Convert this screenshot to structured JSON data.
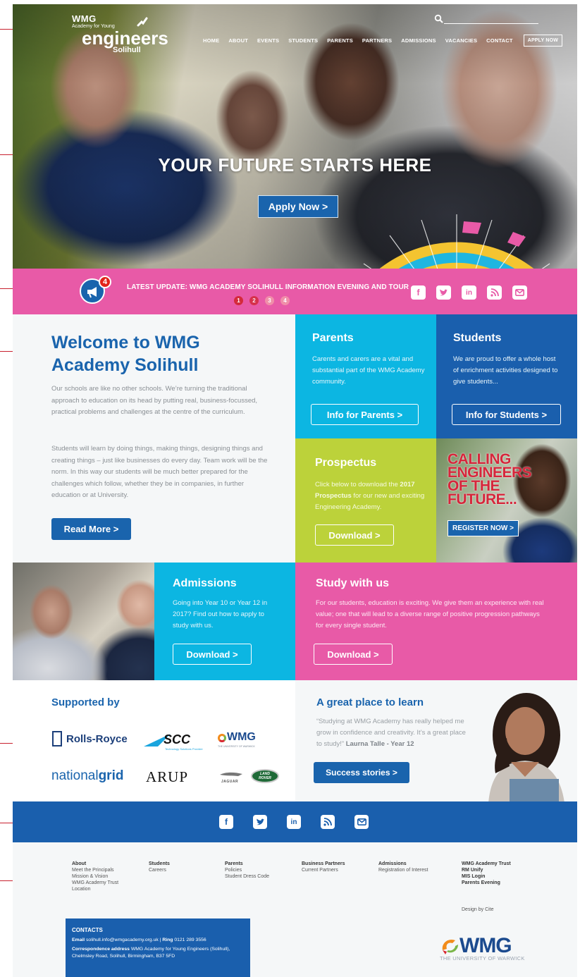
{
  "logo": {
    "line1": "WMG",
    "line2": "Academy for Young",
    "line3": "engineers",
    "line4": "Solihull"
  },
  "nav": {
    "items": [
      "HOME",
      "ABOUT",
      "EVENTS",
      "STUDENTS",
      "PARENTS",
      "PARTNERS",
      "ADMISSIONS",
      "VACANCIES",
      "CONTACT"
    ],
    "apply": "APPLY NOW",
    "search_icon": "search-icon"
  },
  "hero": {
    "title": "YOUR FUTURE STARTS HERE",
    "button": "Apply Now >"
  },
  "ticker": {
    "badge": "4",
    "text": "LATEST UPDATE: WMG ACADEMY SOLIHULL INFORMATION EVENING AND TOUR",
    "dots": [
      "1",
      "2",
      "3",
      "4"
    ],
    "social_icons": [
      "f",
      "t",
      "in",
      "rss",
      "mail"
    ]
  },
  "welcome": {
    "title": "Welcome to WMG Academy Solihull",
    "p1": "Our schools are like no other schools. We’re turning the traditional approach to education on its head by putting real, business-focussed, practical problems and challenges at the centre of the curriculum.",
    "p2": "Students will learn by doing things, making things, designing things and creating things – just like businesses do every day. Team work will be the norm. In this way our students will be much better prepared for the challenges which follow, whether they be in companies, in further education or at University.",
    "button": "Read More  >"
  },
  "parents": {
    "title": "Parents",
    "text": "Carents and carers are a vital and substantial part of the WMG Academy community.",
    "button": "Info for Parents  >"
  },
  "students": {
    "title": "Students",
    "text": "We are proud to offer a whole host of enrichment activities designed to give students...",
    "button": "Info for Students  >"
  },
  "prospectus": {
    "title": "Prospectus",
    "text_a": "Click below to download the ",
    "text_bold": "2017 Prospectus",
    "text_b": " for our new and exciting Engineering Academy.",
    "button": "Download  >"
  },
  "calling": {
    "lines": [
      "CALLING",
      "ENGINEERS",
      "OF THE",
      "FUTURE..."
    ],
    "button": "REGISTER NOW >"
  },
  "admissions": {
    "title": "Admissions",
    "text": "Going into Year 10 or Year 12 in 2017? Find out how to apply to study with us.",
    "button": "Download  >"
  },
  "study": {
    "title": "Study with us",
    "text": "For our students, education is exciting. We give them an experience with real value; one that will lead to a diverse range of positive progression pathways for every single student.",
    "button": "Download  >"
  },
  "supported": {
    "title": "Supported by",
    "logos": [
      "Rolls-Royce",
      "SCC",
      "WMG",
      "nationalgrid",
      "ARUP",
      "JAGUAR",
      "LAND ROVER"
    ],
    "scc_sub": "Technology Solutions Provider",
    "wmg_sub": "THE UNIVERSITY OF WARWICK",
    "ng_a": "national",
    "ng_b": "grid"
  },
  "great": {
    "title": "A great place to learn",
    "quote": "“Studying at WMG Academy has really helped me grow in confidence and creativity. It’s a great place to study!”",
    "author": "Laurna Talle - Year 12",
    "button": "Success stories  >"
  },
  "footer": {
    "columns": [
      {
        "heading": "About",
        "items": [
          "Meet the Principals",
          "Mission & Vision",
          "WMG Academy Trust",
          "Location"
        ]
      },
      {
        "heading": "Students",
        "items": [
          "Careers"
        ]
      },
      {
        "heading": "Parents",
        "items": [
          "Policies",
          "Student Dress Code"
        ]
      },
      {
        "heading": "Business Partners",
        "items": [
          "Current Partners"
        ]
      },
      {
        "heading": "Admissions",
        "items": [
          "Registration of Interest"
        ]
      },
      {
        "heading": "WMG Academy Trust",
        "items": [
          "RM Unify",
          "MIS Login",
          "Parents Evening"
        ]
      }
    ],
    "design": "Design by Cite",
    "contacts_title": "CONTACTS",
    "email_label": "Email",
    "email": "solihull.info@wmgacademy.org.uk",
    "ring_label": "Ring",
    "phone": "0121 289 3556",
    "address_label": "Correspondence address",
    "address": "WMG Academy for Young Engineers (Solihull), Chelmsley Road, Solihull, Birmingham, B37 5FD",
    "logo_word": "WMG",
    "logo_sub": "THE UNIVERSITY OF WARWICK"
  },
  "colors": {
    "pink": "#e85aa7",
    "blue": "#1a64ad",
    "cyan": "#0cb6e2",
    "lime": "#bcd23a",
    "red": "#c8202e"
  }
}
